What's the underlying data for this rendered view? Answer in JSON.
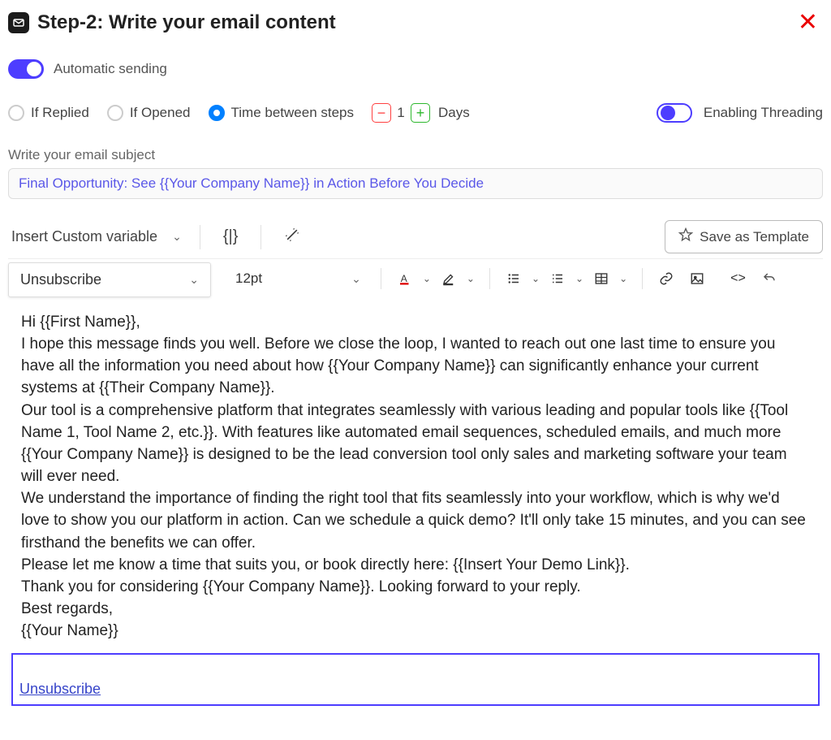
{
  "header": {
    "title": "Step-2:  Write your email content"
  },
  "automatic_sending": {
    "label": "Automatic sending",
    "enabled": true
  },
  "conditions": {
    "if_replied": "If Replied",
    "if_opened": "If Opened",
    "time_between": "Time between steps",
    "value": "1",
    "unit": "Days"
  },
  "threading": {
    "label": "Enabling Threading",
    "enabled": true
  },
  "subject": {
    "label": "Write your email subject",
    "value": "Final Opportunity: See {{Your Company Name}} in Action Before You Decide"
  },
  "toolbar": {
    "insert_variable": "Insert Custom variable",
    "merge_tag": "{|}",
    "save_template": "Save as Template",
    "unsubscribe": "Unsubscribe",
    "font_size": "12pt",
    "code": "<>"
  },
  "body": {
    "p1": "Hi {{First Name}},",
    "p2": "I hope this message finds you well. Before we close the loop, I wanted to reach out one last time to ensure you have all the information you need about how {{Your Company Name}} can significantly enhance your current systems at {{Their Company Name}}.",
    "p3": "Our tool is a comprehensive platform that integrates seamlessly with various leading and popular tools like {{Tool Name 1, Tool Name 2, etc.}}. With features like automated email sequences, scheduled emails, and much more {{Your Company Name}} is designed to be the lead conversion tool only sales and marketing software your team will ever need.",
    "p4": "We understand the importance of finding the right tool that fits seamlessly into your workflow, which is why we'd love to show you our platform in action. Can we schedule a quick demo? It'll only take 15 minutes, and you can see firsthand the benefits we can offer.",
    "p5": "Please let me know a time that suits you, or book directly here: {{Insert Your Demo Link}}.",
    "p6": "Thank you for considering {{Your Company Name}}. Looking forward to your reply.",
    "p7": "Best regards,",
    "p8": "{{Your Name}}",
    "unsubscribe": "Unsubscribe"
  }
}
